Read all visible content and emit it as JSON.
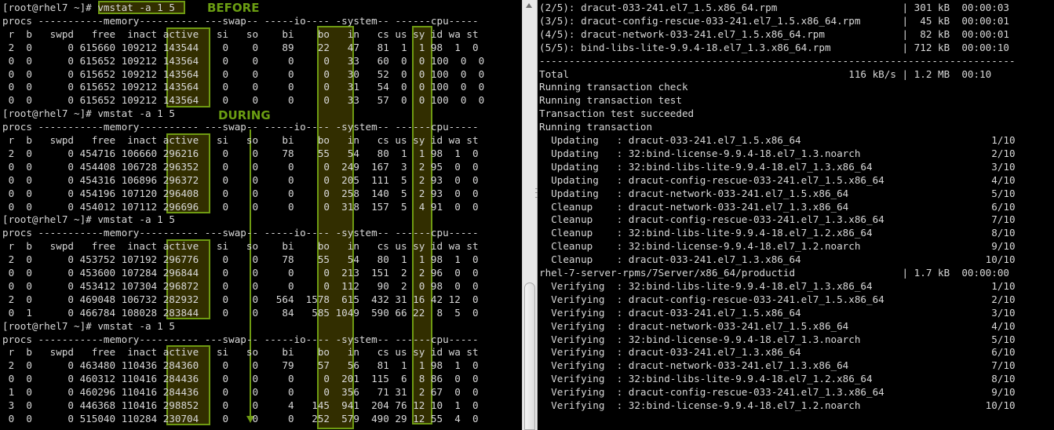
{
  "annotations": {
    "before_label": "BEFORE",
    "during_label": "DURING",
    "highlight_color": "#6e9a12"
  },
  "left_terminal": {
    "prompt": "[root@rhel7 ~]# ",
    "command": "vmstat -a 1 5",
    "group_header": "procs -----------memory---------- ---swap-- -----io---- -system-- ------cpu-----",
    "column_header": " r  b   swpd   free  inact active   si   so    bi    bo   in   cs us sy id wa st",
    "blocks": [
      {
        "rows": [
          " 2  0      0 615660 109212 143544    0    0    89    22   47   81  1  1 98  1  0",
          " 0  0      0 615652 109212 143564    0    0     0     0   33   60  0  0 100  0  0",
          " 0  0      0 615652 109212 143564    0    0     0     0   30   52  0  0 100  0  0",
          " 0  0      0 615652 109212 143564    0    0     0     0   31   54  0  0 100  0  0",
          " 0  0      0 615652 109212 143564    0    0     0     0   33   57  0  0 100  0  0"
        ]
      },
      {
        "rows": [
          " 2  0      0 454716 106660 296216    0    0    78    55   54   80  1  1 98  1  0",
          " 0  0      0 454408 106728 296352    0    0     0     0  249  167  3  2 95  0  0",
          " 0  0      0 454316 106896 296372    0    0     0     0  205  111  5  2 93  0  0",
          " 0  0      0 454196 107120 296408    0    0     0     0  258  140  5  2 93  0  0",
          " 0  0      0 454012 107112 296696    0    0     0     0  318  157  5  4 91  0  0"
        ]
      },
      {
        "rows": [
          " 2  0      0 453752 107192 296776    0    0    78    55   54   80  1  1 98  1  0",
          " 0  0      0 453600 107284 296844    0    0     0     0  213  151  2  2 96  0  0",
          " 0  0      0 453412 107304 296872    0    0     0     0  112   90  2  0 98  0  0",
          " 2  0      0 469048 106732 282932    0    0   564  1578  615  432 31 16 42 12  0",
          " 0  1      0 466784 108028 283844    0    0    84   585 1049  590 66 22  8  5  0"
        ]
      },
      {
        "rows": [
          " 2  0      0 463480 110436 284360    0    0    79    57   56   81  1  1 98  1  0",
          " 0  0      0 460312 110416 284436    0    0     0     0  201  115  6  8 86  0  0",
          " 1  0      0 460296 110416 284436    0    0     0     0  356   71 31  2 67  0  0",
          " 3  0      0 446368 110416 298852    0    0     4   145  941  204 76 12 10  1  0",
          " 0  0      0 515040 110284 230704    0    0     0   252  579  490 29 12 55  4  0"
        ]
      }
    ]
  },
  "right_terminal": {
    "lines": [
      "(2/5): dracut-033-241.el7_1.5.x86_64.rpm                     | 301 kB  00:00:03",
      "(3/5): dracut-config-rescue-033-241.el7_1.5.x86_64.rpm       |  45 kB  00:00:01",
      "(4/5): dracut-network-033-241.el7_1.5.x86_64.rpm             |  82 kB  00:00:01",
      "(5/5): bind-libs-lite-9.9.4-18.el7_1.3.x86_64.rpm            | 712 kB  00:00:10",
      "--------------------------------------------------------------------------------",
      "Total                                               116 kB/s | 1.2 MB  00:10",
      "Running transaction check",
      "Running transaction test",
      "Transaction test succeeded",
      "Running transaction",
      "  Updating   : dracut-033-241.el7_1.5.x86_64                                1/10",
      "  Updating   : 32:bind-license-9.9.4-18.el7_1.3.noarch                      2/10",
      "  Updating   : 32:bind-libs-lite-9.9.4-18.el7_1.3.x86_64                    3/10",
      "  Updating   : dracut-config-rescue-033-241.el7_1.5.x86_64                  4/10",
      "  Updating   : dracut-network-033-241.el7_1.5.x86_64                        5/10",
      "  Cleanup    : dracut-network-033-241.el7_1.3.x86_64                        6/10",
      "  Cleanup    : dracut-config-rescue-033-241.el7_1.3.x86_64                  7/10",
      "  Cleanup    : 32:bind-libs-lite-9.9.4-18.el7_1.2.x86_64                    8/10",
      "  Cleanup    : 32:bind-license-9.9.4-18.el7_1.2.noarch                      9/10",
      "  Cleanup    : dracut-033-241.el7_1.3.x86_64                               10/10",
      "rhel-7-server-rpms/7Server/x86_64/productid                  | 1.7 kB  00:00:00",
      "  Verifying  : 32:bind-libs-lite-9.9.4-18.el7_1.3.x86_64                    1/10",
      "  Verifying  : dracut-config-rescue-033-241.el7_1.5.x86_64                  2/10",
      "  Verifying  : dracut-033-241.el7_1.5.x86_64                                3/10",
      "  Verifying  : dracut-network-033-241.el7_1.5.x86_64                        4/10",
      "  Verifying  : 32:bind-license-9.9.4-18.el7_1.3.noarch                      5/10",
      "  Verifying  : dracut-033-241.el7_1.3.x86_64                                6/10",
      "  Verifying  : dracut-network-033-241.el7_1.3.x86_64                        7/10",
      "  Verifying  : 32:bind-libs-lite-9.9.4-18.el7_1.2.x86_64                    8/10",
      "  Verifying  : dracut-config-rescue-033-241.el7_1.3.x86_64                  9/10",
      "  Verifying  : 32:bind-license-9.9.4-18.el7_1.2.noarch                     10/10"
    ]
  }
}
